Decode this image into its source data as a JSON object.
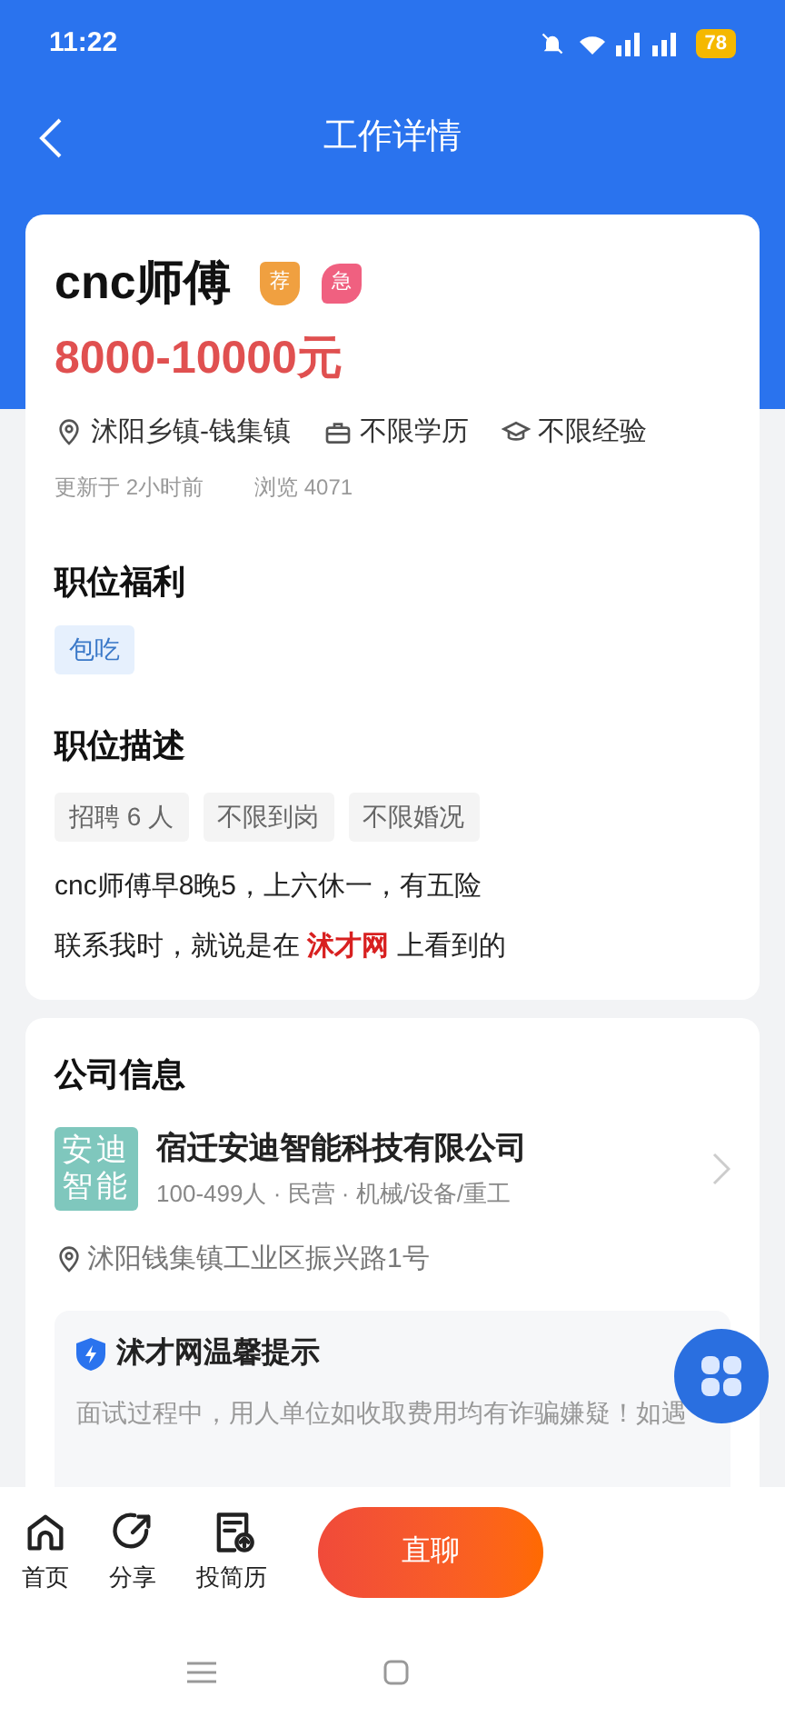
{
  "status_bar": {
    "time": "11:22",
    "battery": "78"
  },
  "header": {
    "title": "工作详情"
  },
  "job": {
    "title": "cnc师傅",
    "badges": [
      {
        "text": "荐",
        "kind": "shield"
      },
      {
        "text": "急",
        "kind": "leaf"
      }
    ],
    "salary": "8000-10000元",
    "meta": [
      {
        "kind": "location",
        "text": "沭阳乡镇-钱集镇"
      },
      {
        "kind": "education",
        "text": "不限学历"
      },
      {
        "kind": "experience",
        "text": "不限经验"
      }
    ],
    "updated": "更新于 2小时前",
    "views": "浏览 4071"
  },
  "benefits": {
    "heading": "职位福利",
    "tags": [
      "包吃"
    ]
  },
  "description": {
    "heading": "职位描述",
    "tags": [
      "招聘 6 人",
      "不限到岗",
      "不限婚况"
    ],
    "lines": [
      "cnc师傅早8晚5，上六休一，有五险",
      "联系我时，就说是在 **沭才网** 上看到的"
    ]
  },
  "company": {
    "heading": "公司信息",
    "logo_text": [
      "安迪",
      "智能"
    ],
    "name": "宿迁安迪智能科技有限公司",
    "details": "100-499人 · 民营 · 机械/设备/重工",
    "address": "沭阳钱集镇工业区振兴路1号"
  },
  "tip": {
    "title": "沭才网温馨提示",
    "text": "面试过程中，用人单位如收取费用均有诈骗嫌疑！如遇"
  },
  "bottom_bar": {
    "actions": [
      {
        "kind": "home",
        "label": "首页"
      },
      {
        "kind": "share",
        "label": "分享"
      },
      {
        "kind": "resume",
        "label": "投简历"
      }
    ],
    "chat_button": "直聊"
  }
}
